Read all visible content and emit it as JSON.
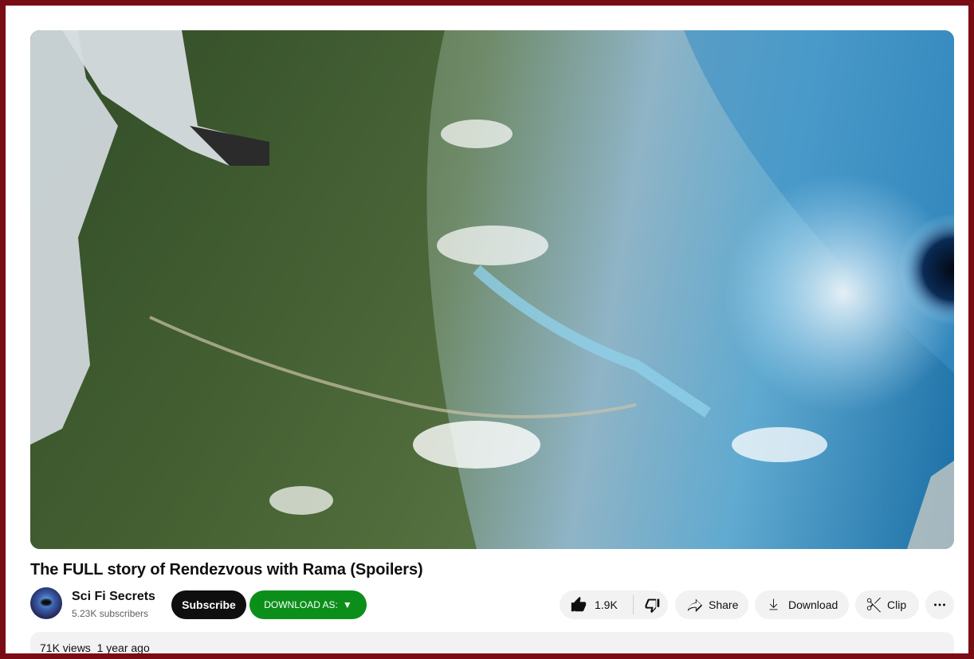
{
  "video": {
    "title": "The FULL story of Rendezvous with Rama (Spoilers)"
  },
  "channel": {
    "name": "Sci Fi Secrets",
    "subscribers": "5.23K subscribers",
    "subscribe_label": "Subscribe",
    "download_as_label": "DOWNLOAD AS:",
    "download_as_arrow": "▼"
  },
  "actions": {
    "like_count": "1.9K",
    "share_label": "Share",
    "download_label": "Download",
    "clip_label": "Clip"
  },
  "description": {
    "views": "71K views",
    "age": "1 year ago"
  },
  "colors": {
    "frame": "#7a0c16",
    "subscribe_bg": "#0f0f0f",
    "download_as_bg": "#0c8f1a",
    "pill_bg": "#f2f2f2"
  },
  "icons": [
    "thumbs-up-icon",
    "thumbs-down-icon",
    "share-icon",
    "download-icon",
    "scissors-icon",
    "more-icon"
  ]
}
